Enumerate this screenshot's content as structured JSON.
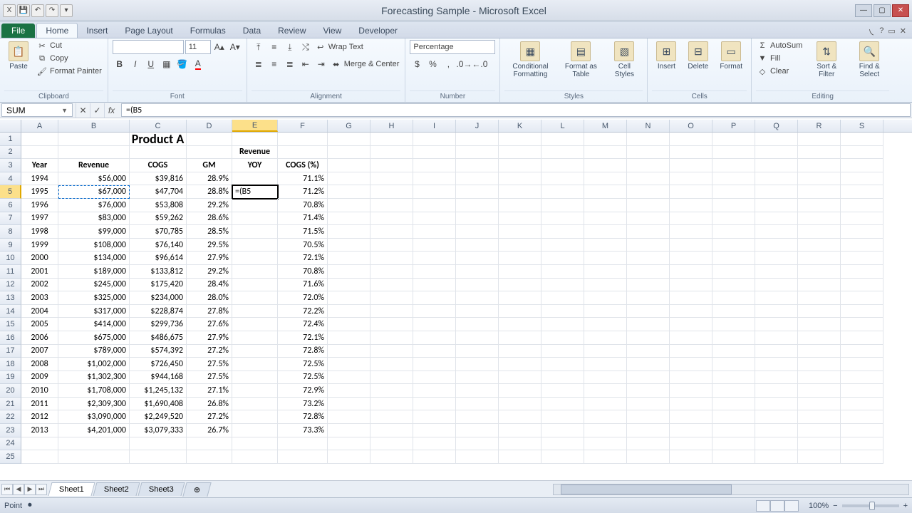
{
  "app": {
    "title": "Forecasting Sample - Microsoft Excel"
  },
  "qat": {
    "save": "💾",
    "undo": "↶",
    "redo": "↷"
  },
  "tabs": {
    "file": "File",
    "items": [
      "Home",
      "Insert",
      "Page Layout",
      "Formulas",
      "Data",
      "Review",
      "View",
      "Developer"
    ],
    "active": "Home"
  },
  "ribbon": {
    "clipboard": {
      "label": "Clipboard",
      "paste": "Paste",
      "cut": "Cut",
      "copy": "Copy",
      "fmtpainter": "Format Painter"
    },
    "font": {
      "label": "Font",
      "family": "",
      "size": "11",
      "bold": "B",
      "italic": "I",
      "underline": "U"
    },
    "alignment": {
      "label": "Alignment",
      "wrap": "Wrap Text",
      "merge": "Merge & Center"
    },
    "number": {
      "label": "Number",
      "format": "Percentage"
    },
    "styles": {
      "label": "Styles",
      "cond": "Conditional Formatting",
      "table": "Format as Table",
      "cell": "Cell Styles"
    },
    "cells": {
      "label": "Cells",
      "insert": "Insert",
      "delete": "Delete",
      "format": "Format"
    },
    "editing": {
      "label": "Editing",
      "autosum": "AutoSum",
      "fill": "Fill",
      "clear": "Clear",
      "sort": "Sort & Filter",
      "find": "Find & Select"
    }
  },
  "namebox": "SUM",
  "formula": "=(B5",
  "columns": [
    "A",
    "B",
    "C",
    "D",
    "E",
    "F",
    "G",
    "H",
    "I",
    "J",
    "K",
    "L",
    "M",
    "N",
    "O",
    "P",
    "Q",
    "R",
    "S"
  ],
  "activeCol": "E",
  "activeRow": 5,
  "marchingCell": "B5",
  "editingCell": "E5",
  "editingText": "=(B5",
  "sheet": {
    "title": "Product A",
    "header2": {
      "E": "Revenue"
    },
    "header3": {
      "A": "Year",
      "B": "Revenue",
      "C": "COGS",
      "D": "GM",
      "E": "YOY",
      "F": "COGS (%)"
    },
    "rows": [
      {
        "r": 4,
        "A": "1994",
        "B": "$56,000",
        "C": "$39,816",
        "D": "28.9%",
        "E": "",
        "F": "71.1%"
      },
      {
        "r": 5,
        "A": "1995",
        "B": "$67,000",
        "C": "$47,704",
        "D": "28.8%",
        "E": "",
        "F": "71.2%"
      },
      {
        "r": 6,
        "A": "1996",
        "B": "$76,000",
        "C": "$53,808",
        "D": "29.2%",
        "E": "",
        "F": "70.8%"
      },
      {
        "r": 7,
        "A": "1997",
        "B": "$83,000",
        "C": "$59,262",
        "D": "28.6%",
        "E": "",
        "F": "71.4%"
      },
      {
        "r": 8,
        "A": "1998",
        "B": "$99,000",
        "C": "$70,785",
        "D": "28.5%",
        "E": "",
        "F": "71.5%"
      },
      {
        "r": 9,
        "A": "1999",
        "B": "$108,000",
        "C": "$76,140",
        "D": "29.5%",
        "E": "",
        "F": "70.5%"
      },
      {
        "r": 10,
        "A": "2000",
        "B": "$134,000",
        "C": "$96,614",
        "D": "27.9%",
        "E": "",
        "F": "72.1%"
      },
      {
        "r": 11,
        "A": "2001",
        "B": "$189,000",
        "C": "$133,812",
        "D": "29.2%",
        "E": "",
        "F": "70.8%"
      },
      {
        "r": 12,
        "A": "2002",
        "B": "$245,000",
        "C": "$175,420",
        "D": "28.4%",
        "E": "",
        "F": "71.6%"
      },
      {
        "r": 13,
        "A": "2003",
        "B": "$325,000",
        "C": "$234,000",
        "D": "28.0%",
        "E": "",
        "F": "72.0%"
      },
      {
        "r": 14,
        "A": "2004",
        "B": "$317,000",
        "C": "$228,874",
        "D": "27.8%",
        "E": "",
        "F": "72.2%"
      },
      {
        "r": 15,
        "A": "2005",
        "B": "$414,000",
        "C": "$299,736",
        "D": "27.6%",
        "E": "",
        "F": "72.4%"
      },
      {
        "r": 16,
        "A": "2006",
        "B": "$675,000",
        "C": "$486,675",
        "D": "27.9%",
        "E": "",
        "F": "72.1%"
      },
      {
        "r": 17,
        "A": "2007",
        "B": "$789,000",
        "C": "$574,392",
        "D": "27.2%",
        "E": "",
        "F": "72.8%"
      },
      {
        "r": 18,
        "A": "2008",
        "B": "$1,002,000",
        "C": "$726,450",
        "D": "27.5%",
        "E": "",
        "F": "72.5%"
      },
      {
        "r": 19,
        "A": "2009",
        "B": "$1,302,300",
        "C": "$944,168",
        "D": "27.5%",
        "E": "",
        "F": "72.5%"
      },
      {
        "r": 20,
        "A": "2010",
        "B": "$1,708,000",
        "C": "$1,245,132",
        "D": "27.1%",
        "E": "",
        "F": "72.9%"
      },
      {
        "r": 21,
        "A": "2011",
        "B": "$2,309,300",
        "C": "$1,690,408",
        "D": "26.8%",
        "E": "",
        "F": "73.2%"
      },
      {
        "r": 22,
        "A": "2012",
        "B": "$3,090,000",
        "C": "$2,249,520",
        "D": "27.2%",
        "E": "",
        "F": "72.8%"
      },
      {
        "r": 23,
        "A": "2013",
        "B": "$4,201,000",
        "C": "$3,079,333",
        "D": "26.7%",
        "E": "",
        "F": "73.3%"
      }
    ]
  },
  "sheets": {
    "list": [
      "Sheet1",
      "Sheet2",
      "Sheet3"
    ],
    "active": "Sheet1"
  },
  "status": {
    "mode": "Point",
    "zoom": "100%"
  },
  "chart_data": {
    "type": "table",
    "title": "Product A",
    "columns": [
      "Year",
      "Revenue",
      "COGS",
      "GM",
      "Revenue YOY",
      "COGS (%)"
    ],
    "data": [
      [
        1994,
        56000,
        39816,
        0.289,
        null,
        0.711
      ],
      [
        1995,
        67000,
        47704,
        0.288,
        null,
        0.712
      ],
      [
        1996,
        76000,
        53808,
        0.292,
        null,
        0.708
      ],
      [
        1997,
        83000,
        59262,
        0.286,
        null,
        0.714
      ],
      [
        1998,
        99000,
        70785,
        0.285,
        null,
        0.715
      ],
      [
        1999,
        108000,
        76140,
        0.295,
        null,
        0.705
      ],
      [
        2000,
        134000,
        96614,
        0.279,
        null,
        0.721
      ],
      [
        2001,
        189000,
        133812,
        0.292,
        null,
        0.708
      ],
      [
        2002,
        245000,
        175420,
        0.284,
        null,
        0.716
      ],
      [
        2003,
        325000,
        234000,
        0.28,
        null,
        0.72
      ],
      [
        2004,
        317000,
        228874,
        0.278,
        null,
        0.722
      ],
      [
        2005,
        414000,
        299736,
        0.276,
        null,
        0.724
      ],
      [
        2006,
        675000,
        486675,
        0.279,
        null,
        0.721
      ],
      [
        2007,
        789000,
        574392,
        0.272,
        null,
        0.728
      ],
      [
        2008,
        1002000,
        726450,
        0.275,
        null,
        0.725
      ],
      [
        2009,
        1302300,
        944168,
        0.275,
        null,
        0.725
      ],
      [
        2010,
        1708000,
        1245132,
        0.271,
        null,
        0.729
      ],
      [
        2011,
        2309300,
        1690408,
        0.268,
        null,
        0.732
      ],
      [
        2012,
        3090000,
        2249520,
        0.272,
        null,
        0.728
      ],
      [
        2013,
        4201000,
        3079333,
        0.267,
        null,
        0.733
      ]
    ]
  }
}
